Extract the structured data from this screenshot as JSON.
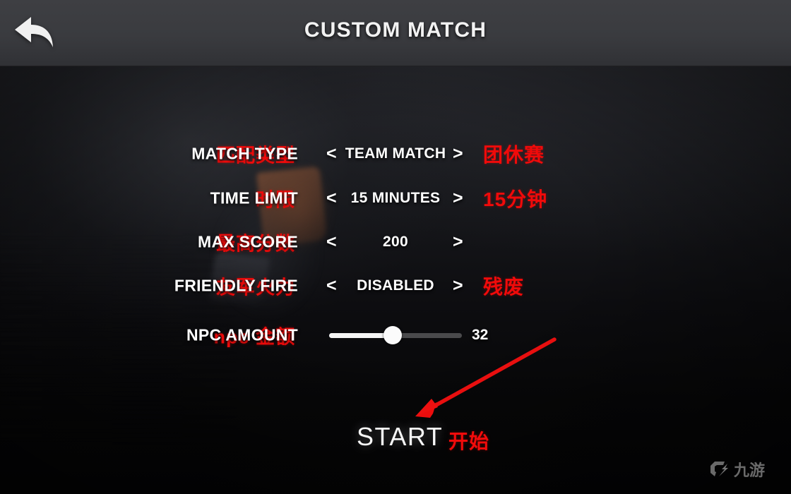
{
  "header": {
    "title": "CUSTOM MATCH",
    "back_icon": "back-arrow-icon"
  },
  "options": [
    {
      "zh_label": "匹配类型",
      "label": "MATCH TYPE",
      "prev": "<",
      "next": ">",
      "value": "TEAM MATCH",
      "zh_value": "团休赛"
    },
    {
      "zh_label": "时限",
      "label": "TIME LIMIT",
      "prev": "<",
      "next": ">",
      "value": "15 MINUTES",
      "zh_value": "15分钟"
    },
    {
      "zh_label": "最高分数",
      "label": "MAX SCORE",
      "prev": "<",
      "next": ">",
      "value": "200",
      "zh_value": ""
    },
    {
      "zh_label": "友军火力",
      "label": "FRIENDLY FIRE",
      "prev": "<",
      "next": ">",
      "value": "DISABLED",
      "zh_value": "残废"
    }
  ],
  "slider_row": {
    "zh_label": "npc 金额",
    "label": "NPC AMOUNT",
    "value": "32",
    "fill_percent": 48
  },
  "start": {
    "label": "START",
    "zh_label": "开始"
  },
  "watermark": {
    "text": "九游",
    "mark": "g-logo-icon"
  },
  "colors": {
    "annotation_red": "#ee0b0b",
    "text_white": "#ffffff",
    "header_bg": "#3a3b3f",
    "body_bg": "#0d0d10",
    "slider_fill": "#f5f5f5",
    "slider_track": "#4a4a4c"
  }
}
